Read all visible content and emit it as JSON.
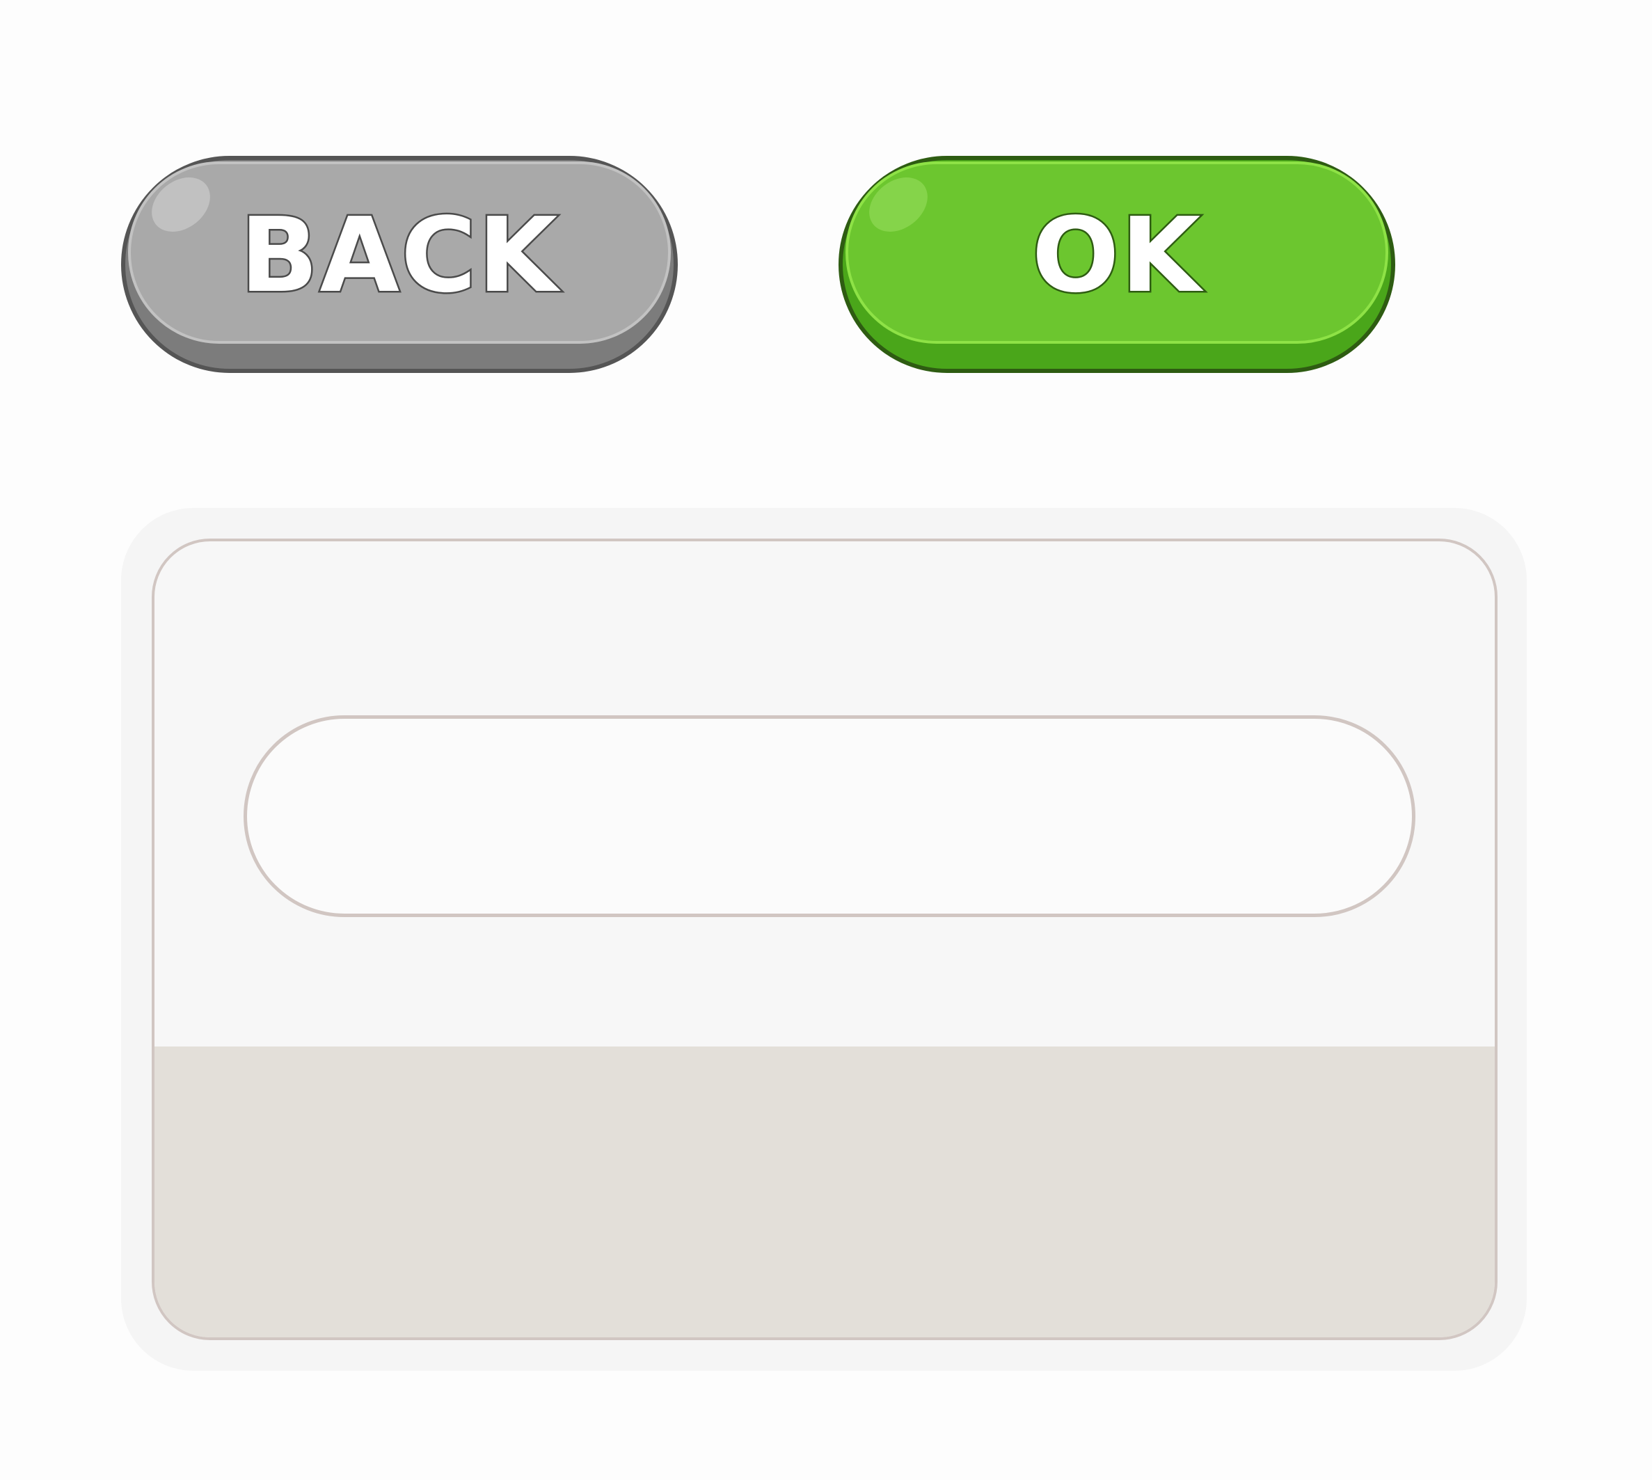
{
  "buttons": {
    "back_label": "BACK",
    "ok_label": "OK"
  },
  "panel": {
    "input_value": "",
    "input_placeholder": ""
  },
  "colors": {
    "back_face": "#a9a9a9",
    "back_outline": "#555555",
    "ok_face": "#6cc62f",
    "ok_outline": "#2e5c12",
    "panel_border": "#d1c6c2",
    "panel_footer": "#e3dfd9"
  },
  "icons": [
    "gloss-highlight-icon"
  ]
}
